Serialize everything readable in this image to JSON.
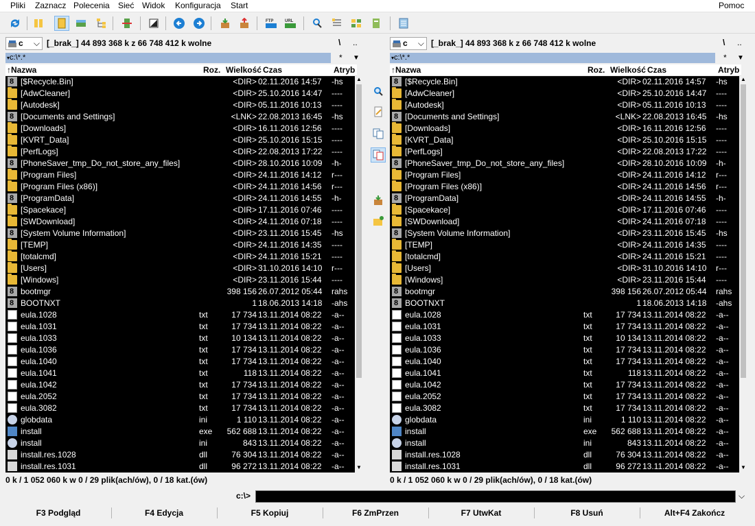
{
  "menu": [
    "Pliki",
    "Zaznacz",
    "Polecenia",
    "Sieć",
    "Widok",
    "Konfiguracja",
    "Start"
  ],
  "menu_help": "Pomoc",
  "toolbar": {
    "icons": [
      "refresh-icon",
      "brief-view-icon",
      "full-view-icon",
      "thumbnails-view-icon",
      "tree-view-icon",
      "invert-selection-icon",
      "back-icon",
      "forward-icon",
      "pack-icon",
      "unpack-icon",
      "ftp-icon",
      "url-icon",
      "search-icon",
      "multi-rename-icon",
      "sync-dirs-icon",
      "compare-files-icon",
      "notepad-icon"
    ],
    "ftp_label": "FTP",
    "url_label": "URL"
  },
  "columns": {
    "name": "Nazwa",
    "ext": "Roz.",
    "size": "Wielkość",
    "date": "Czas",
    "attr": "Atryb"
  },
  "left": {
    "drive": "c",
    "drive_info": "[_brak_]  44 893 368 k z 66 748 412 k wolne",
    "root": "\\",
    "up": "..",
    "path": "c:\\*.*",
    "path_star": "*",
    "status": "0 k / 1 052 060 k w 0 / 29 plik(ach/ów), 0 / 18 kat.(ów)"
  },
  "right": {
    "drive": "c",
    "drive_info": "[_brak_]  44 893 368 k z 66 748 412 k wolne",
    "root": "\\",
    "up": "..",
    "path": "c:\\*.*",
    "path_star": "*",
    "status": "0 k / 1 052 060 k w 0 / 29 plik(ach/ów), 0 / 18 kat.(ów)"
  },
  "files": [
    {
      "name": "[$Recycle.Bin]",
      "ext": "",
      "size": "<DIR>",
      "date": "02.11.2016 14:57",
      "attr": "-hs",
      "icon": "lnk"
    },
    {
      "name": "[AdwCleaner]",
      "ext": "",
      "size": "<DIR>",
      "date": "25.10.2016 14:47",
      "attr": "----",
      "icon": "folder"
    },
    {
      "name": "[Autodesk]",
      "ext": "",
      "size": "<DIR>",
      "date": "05.11.2016 10:13",
      "attr": "----",
      "icon": "folder"
    },
    {
      "name": "[Documents and Settings]",
      "ext": "",
      "size": "<LNK>",
      "date": "22.08.2013 16:45",
      "attr": "-hs",
      "icon": "lnk"
    },
    {
      "name": "[Downloads]",
      "ext": "",
      "size": "<DIR>",
      "date": "16.11.2016 12:56",
      "attr": "----",
      "icon": "folder"
    },
    {
      "name": "[KVRT_Data]",
      "ext": "",
      "size": "<DIR>",
      "date": "25.10.2016 15:15",
      "attr": "----",
      "icon": "folder"
    },
    {
      "name": "[PerfLogs]",
      "ext": "",
      "size": "<DIR>",
      "date": "22.08.2013 17:22",
      "attr": "----",
      "icon": "folder"
    },
    {
      "name": "[PhoneSaver_tmp_Do_not_store_any_files]",
      "ext": "",
      "size": "<DIR>",
      "date": "28.10.2016 10:09",
      "attr": "-h-",
      "icon": "lnk"
    },
    {
      "name": "[Program Files]",
      "ext": "",
      "size": "<DIR>",
      "date": "24.11.2016 14:12",
      "attr": "r---",
      "icon": "folder"
    },
    {
      "name": "[Program Files (x86)]",
      "ext": "",
      "size": "<DIR>",
      "date": "24.11.2016 14:56",
      "attr": "r---",
      "icon": "folder"
    },
    {
      "name": "[ProgramData]",
      "ext": "",
      "size": "<DIR>",
      "date": "24.11.2016 14:55",
      "attr": "-h-",
      "icon": "lnk"
    },
    {
      "name": "[Spacekace]",
      "ext": "",
      "size": "<DIR>",
      "date": "17.11.2016 07:46",
      "attr": "----",
      "icon": "folder"
    },
    {
      "name": "[SWDownload]",
      "ext": "",
      "size": "<DIR>",
      "date": "24.11.2016 07:18",
      "attr": "----",
      "icon": "folder"
    },
    {
      "name": "[System Volume Information]",
      "ext": "",
      "size": "<DIR>",
      "date": "23.11.2016 15:45",
      "attr": "-hs",
      "icon": "lnk"
    },
    {
      "name": "[TEMP]",
      "ext": "",
      "size": "<DIR>",
      "date": "24.11.2016 14:35",
      "attr": "----",
      "icon": "folder"
    },
    {
      "name": "[totalcmd]",
      "ext": "",
      "size": "<DIR>",
      "date": "24.11.2016 15:21",
      "attr": "----",
      "icon": "folder"
    },
    {
      "name": "[Users]",
      "ext": "",
      "size": "<DIR>",
      "date": "31.10.2016 14:10",
      "attr": "r---",
      "icon": "folder"
    },
    {
      "name": "[Windows]",
      "ext": "",
      "size": "<DIR>",
      "date": "23.11.2016 15:44",
      "attr": "----",
      "icon": "folder"
    },
    {
      "name": "bootmgr",
      "ext": "",
      "size": "398 156",
      "date": "26.07.2012 05:44",
      "attr": "rahs",
      "icon": "lnk"
    },
    {
      "name": "BOOTNXT",
      "ext": "",
      "size": "1",
      "date": "18.06.2013 14:18",
      "attr": "-ahs",
      "icon": "lnk"
    },
    {
      "name": "eula.1028",
      "ext": "txt",
      "size": "17 734",
      "date": "13.11.2014 08:22",
      "attr": "-a--",
      "icon": "file"
    },
    {
      "name": "eula.1031",
      "ext": "txt",
      "size": "17 734",
      "date": "13.11.2014 08:22",
      "attr": "-a--",
      "icon": "file"
    },
    {
      "name": "eula.1033",
      "ext": "txt",
      "size": "10 134",
      "date": "13.11.2014 08:22",
      "attr": "-a--",
      "icon": "file"
    },
    {
      "name": "eula.1036",
      "ext": "txt",
      "size": "17 734",
      "date": "13.11.2014 08:22",
      "attr": "-a--",
      "icon": "file"
    },
    {
      "name": "eula.1040",
      "ext": "txt",
      "size": "17 734",
      "date": "13.11.2014 08:22",
      "attr": "-a--",
      "icon": "file"
    },
    {
      "name": "eula.1041",
      "ext": "txt",
      "size": "118",
      "date": "13.11.2014 08:22",
      "attr": "-a--",
      "icon": "file"
    },
    {
      "name": "eula.1042",
      "ext": "txt",
      "size": "17 734",
      "date": "13.11.2014 08:22",
      "attr": "-a--",
      "icon": "file"
    },
    {
      "name": "eula.2052",
      "ext": "txt",
      "size": "17 734",
      "date": "13.11.2014 08:22",
      "attr": "-a--",
      "icon": "file"
    },
    {
      "name": "eula.3082",
      "ext": "txt",
      "size": "17 734",
      "date": "13.11.2014 08:22",
      "attr": "-a--",
      "icon": "file"
    },
    {
      "name": "globdata",
      "ext": "ini",
      "size": "1 110",
      "date": "13.11.2014 08:22",
      "attr": "-a--",
      "icon": "gear"
    },
    {
      "name": "install",
      "ext": "exe",
      "size": "562 688",
      "date": "13.11.2014 08:22",
      "attr": "-a--",
      "icon": "exe"
    },
    {
      "name": "install",
      "ext": "ini",
      "size": "843",
      "date": "13.11.2014 08:22",
      "attr": "-a--",
      "icon": "gear"
    },
    {
      "name": "install.res.1028",
      "ext": "dll",
      "size": "76 304",
      "date": "13.11.2014 08:22",
      "attr": "-a--",
      "icon": "sys"
    },
    {
      "name": "install.res.1031",
      "ext": "dll",
      "size": "96 272",
      "date": "13.11.2014 08:22",
      "attr": "-a--",
      "icon": "sys"
    }
  ],
  "middle_buttons": [
    "view-icon",
    "edit-icon",
    "copy-icon",
    "move-icon",
    "pack-icon",
    "new-folder-icon"
  ],
  "cmdline": {
    "label": "c:\\>",
    "value": ""
  },
  "fkeys": [
    "F3 Podgląd",
    "F4 Edycja",
    "F5 Kopiuj",
    "F6 ZmPrzen",
    "F7 UtwKat",
    "F8 Usuń",
    "Alt+F4 Zakończ"
  ],
  "colors": {
    "list_bg": "#000000",
    "list_fg": "#ffffff",
    "path_active": "#9fb9db",
    "toolbar_active": "#cce4f7"
  }
}
